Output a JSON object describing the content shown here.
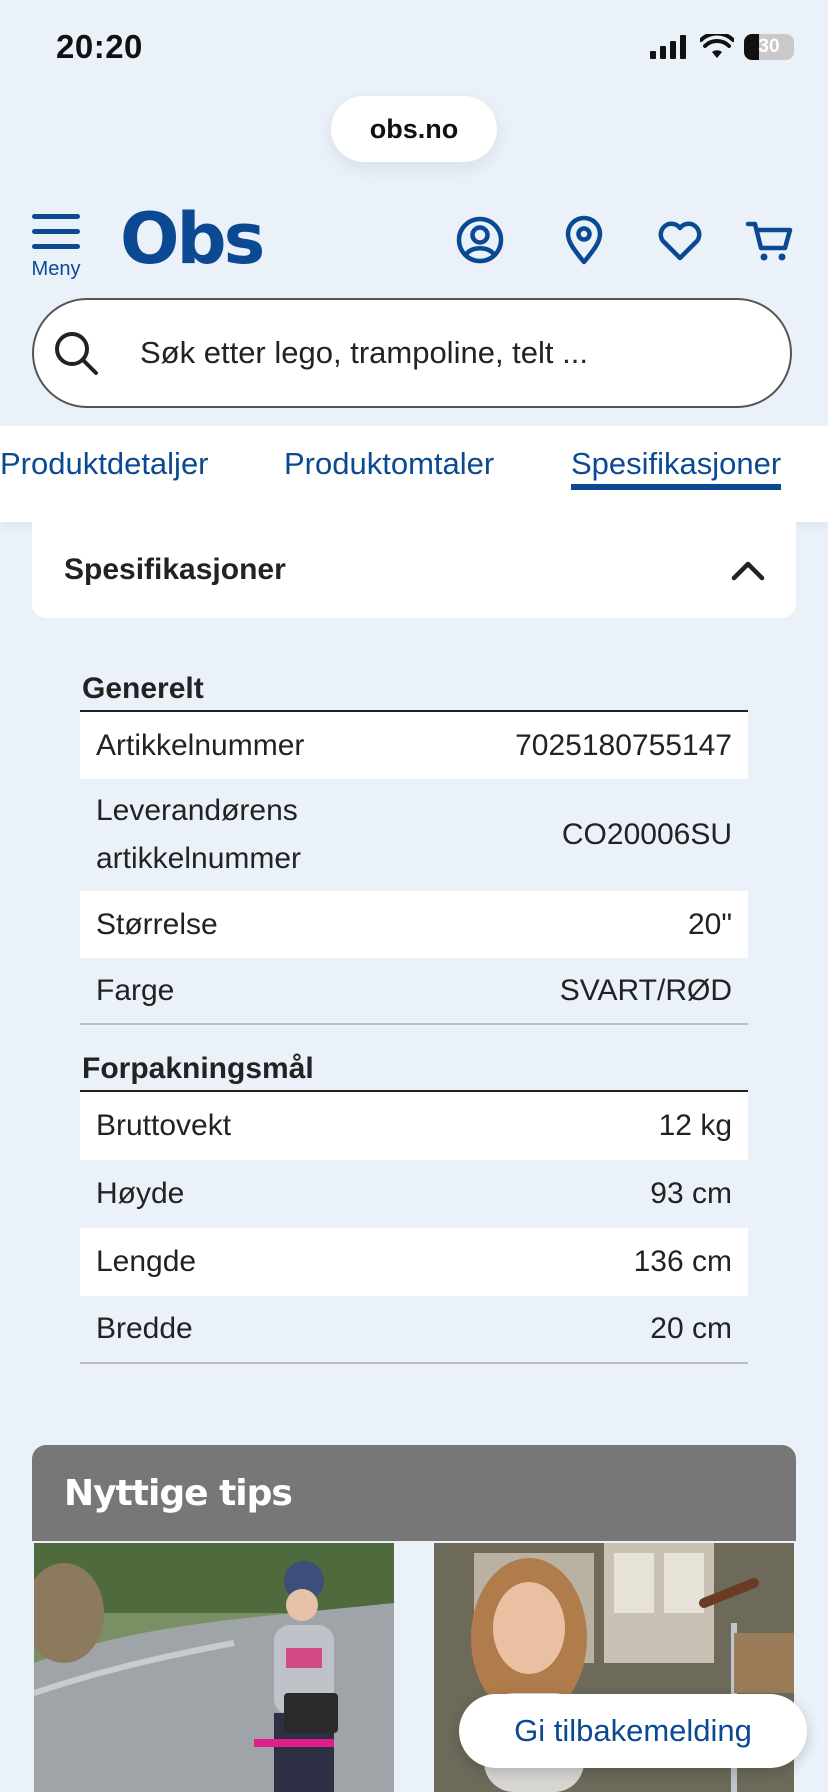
{
  "status_bar": {
    "time": "20:20",
    "battery": "30"
  },
  "browser": {
    "url": "obs.no"
  },
  "header": {
    "menu_label": "Meny",
    "logo": "Obs",
    "icons": [
      "account-icon",
      "store-location-icon",
      "favorites-icon",
      "cart-icon"
    ]
  },
  "search": {
    "placeholder": "Søk etter lego, trampoline, telt ..."
  },
  "tabs": [
    {
      "label": "Produktdetaljer"
    },
    {
      "label": "Produktomtaler"
    },
    {
      "label": "Spesifikasjoner",
      "active": true
    }
  ],
  "accordion": {
    "title": "Spesifikasjoner",
    "expanded": true
  },
  "specs": {
    "general": {
      "heading": "Generelt",
      "rows": [
        {
          "label": "Artikkelnummer",
          "value": "7025180755147"
        },
        {
          "label_line1": "Leverandørens",
          "label_line2": "artikkelnummer",
          "value": "CO20006SU"
        },
        {
          "label": "Størrelse",
          "value": "20\""
        },
        {
          "label": "Farge",
          "value": "SVART/RØD"
        }
      ]
    },
    "packaging": {
      "heading": "Forpakningsmål",
      "rows": [
        {
          "label": "Bruttovekt",
          "value": "12 kg"
        },
        {
          "label": "Høyde",
          "value": "93 cm"
        },
        {
          "label": "Lengde",
          "value": "136 cm"
        },
        {
          "label": "Bredde",
          "value": "20 cm"
        }
      ]
    }
  },
  "tips": {
    "title": "Nyttige tips"
  },
  "feedback": {
    "label": "Gi tilbakemelding"
  },
  "colors": {
    "brand": "#0b4a92",
    "background": "#eaf1f9",
    "tips_header": "#777777"
  }
}
